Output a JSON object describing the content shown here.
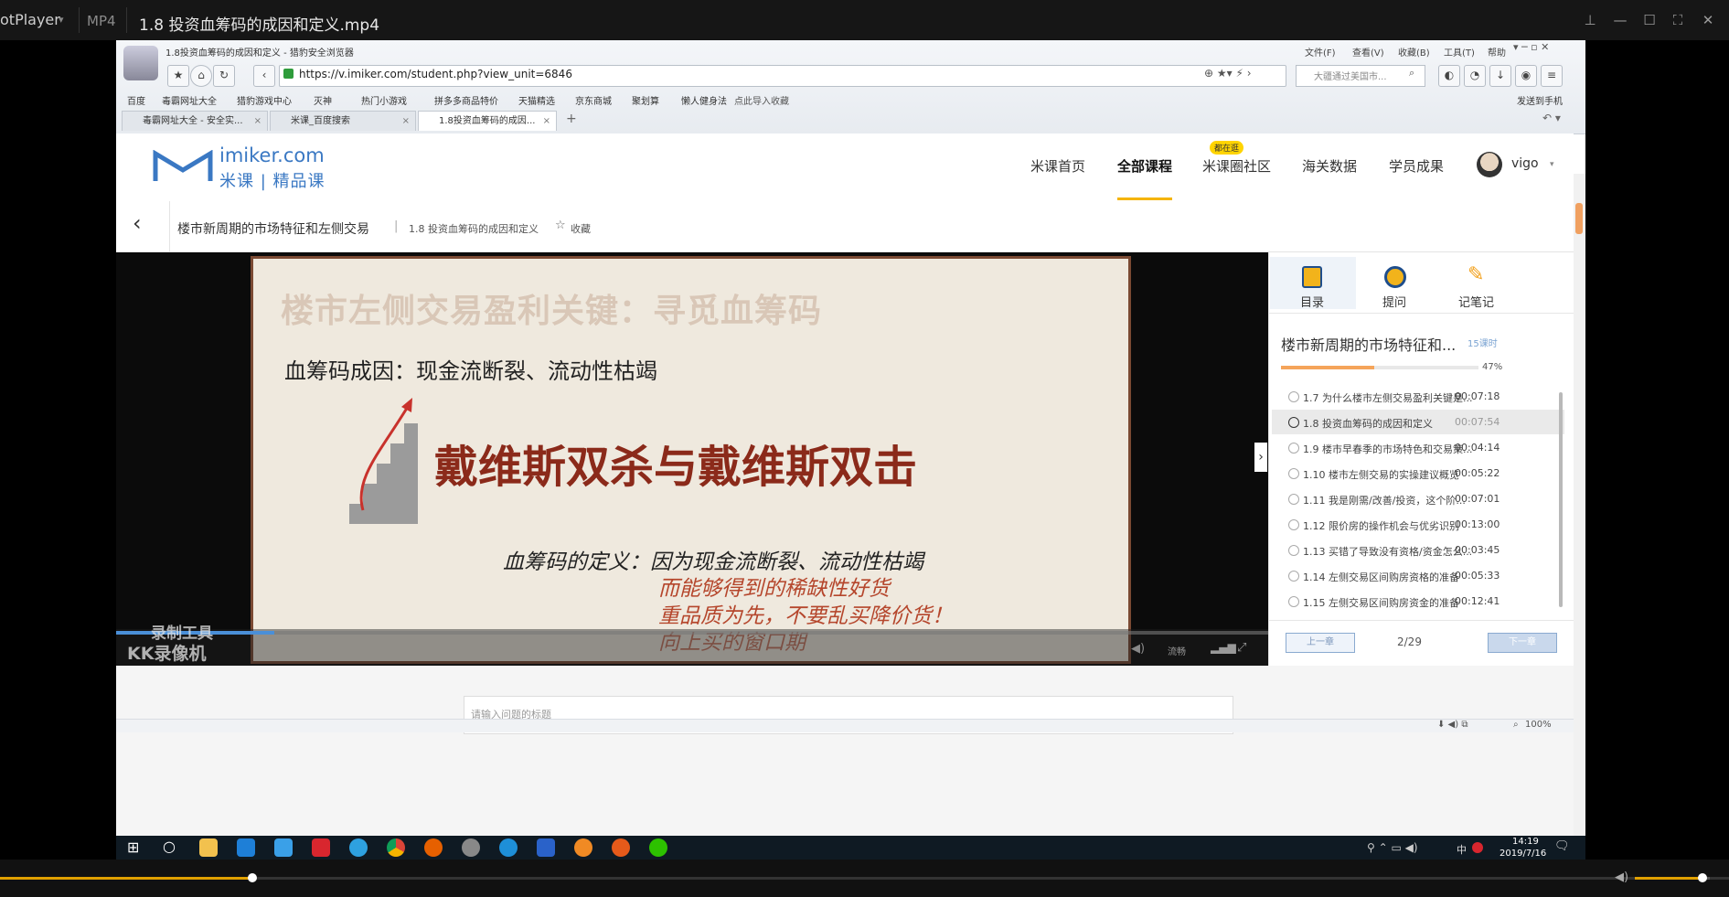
{
  "player": {
    "app_name": "otPlayer",
    "format": "MP4",
    "file_title": "1.8 投资血筹码的成因和定义.mp4",
    "progress_fraction": 0.146,
    "volume_fraction": 0.9
  },
  "browser": {
    "window_title": "1.8投资血筹码的成因和定义 - 猎豹安全浏览器",
    "menu": [
      "文件(F)",
      "查看(V)",
      "收藏(B)",
      "工具(T)",
      "帮助"
    ],
    "url": "https://v.imiker.com/student.php?view_unit=6846",
    "search_placeholder": "大疆通过美国市...",
    "send_to_phone": "发送到手机",
    "bookmarks": [
      "百度",
      "毒霸网址大全",
      "猎豹游戏中心",
      "灭神",
      "热门小游戏",
      "拼多多商品特价",
      "天猫精选",
      "京东商城",
      "聚划算",
      "懒人健身法",
      "点此导入收藏"
    ],
    "tabs": [
      {
        "label": "毒霸网址大全 - 安全实..."
      },
      {
        "label": "米课_百度搜索"
      },
      {
        "label": "1.8投资血筹码的成因..."
      }
    ],
    "status": {
      "zoom": "100%"
    }
  },
  "site": {
    "logo_top": "imiker.com",
    "logo_bottom": "米课 | 精品课",
    "nav": [
      "米课首页",
      "全部课程",
      "米课圈社区",
      "海关数据",
      "学员成果"
    ],
    "nav_badge": "都在逛",
    "active_nav": "全部课程",
    "user_name": "vigo"
  },
  "course": {
    "title": "楼市新周期的市场特征和左侧交易",
    "unit": "1.8 投资血筹码的成因和定义",
    "favorite": "收藏"
  },
  "slide": {
    "heading": "楼市左侧交易盈利关键：寻觅血筹码",
    "cause": "血筹码成因：现金流断裂、流动性枯竭",
    "big": "戴维斯双杀与戴维斯双击",
    "def1": "血筹码的定义：因为现金流断裂、流动性枯竭",
    "def2": "而能够得到的稀缺性好货",
    "def3": "重品质为先，不要乱买降价货！",
    "def4": "向上买的窗口期",
    "watermark1": "录制工具",
    "watermark2": "KK录像机",
    "speed_label": "流畅"
  },
  "side": {
    "tabs": [
      "目录",
      "提问",
      "记笔记"
    ],
    "course_title": "楼市新周期的市场特征和...",
    "lesson_count": "15课时",
    "progress_text": "47%",
    "progress_value": 0.47,
    "lessons": [
      {
        "title": "1.7 为什么楼市左侧交易盈利关键是...",
        "dur": "00:07:18"
      },
      {
        "title": "1.8 投资血筹码的成因和定义",
        "dur": "00:07:54"
      },
      {
        "title": "1.9 楼市早春季的市场特色和交易策...",
        "dur": "00:04:14"
      },
      {
        "title": "1.10 楼市左侧交易的实操建议概览",
        "dur": "00:05:22"
      },
      {
        "title": "1.11 我是刚需/改善/投资，这个阶...",
        "dur": "00:07:01"
      },
      {
        "title": "1.12 限价房的操作机会与优劣识别",
        "dur": "00:13:00"
      },
      {
        "title": "1.13 买错了导致没有资格/资金怎么...",
        "dur": "00:03:45"
      },
      {
        "title": "1.14 左侧交易区间购房资格的准备",
        "dur": "00:05:33"
      },
      {
        "title": "1.15 左侧交易区间购房资金的准备",
        "dur": "00:12:41"
      }
    ],
    "prev": "上一章",
    "next": "下一章",
    "page": "2/29"
  },
  "question": {
    "placeholder": "请输入问题的标题"
  },
  "taskbar": {
    "time": "14:19",
    "date": "2019/7/16",
    "ime": "中",
    "icons": [
      "start-icon",
      "cortana-icon",
      "explorer-icon",
      "edge-icon",
      "ie-icon",
      "app-red-icon",
      "qq-browser-icon",
      "chrome-icon",
      "firefox-icon",
      "app-icon",
      "search-app-icon",
      "app-blue-icon",
      "app-orange-icon",
      "app-fox-icon",
      "wechat-icon"
    ]
  }
}
